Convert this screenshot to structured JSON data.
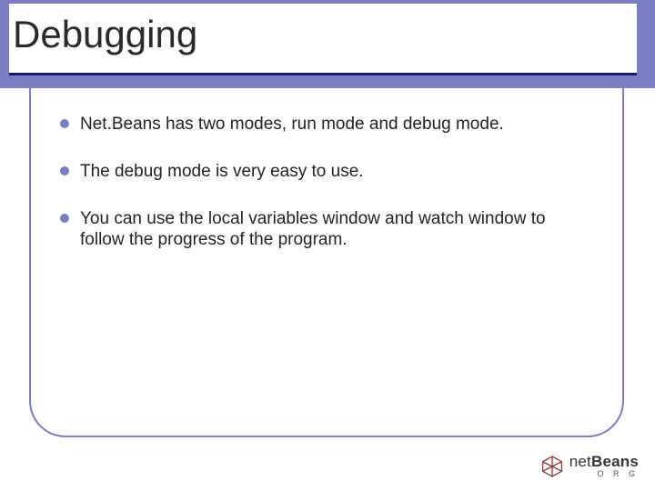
{
  "title": "Debugging",
  "bullets": [
    "Net.Beans has two modes, run mode and debug mode.",
    "The debug mode is very easy to use.",
    "You can use the local variables window and watch window to follow the progress of the program."
  ],
  "logo": {
    "net": "net",
    "beans": "Beans",
    "org": "O R G"
  },
  "colors": {
    "accent": "#7b7ec2",
    "underline": "#1a1a6a"
  }
}
